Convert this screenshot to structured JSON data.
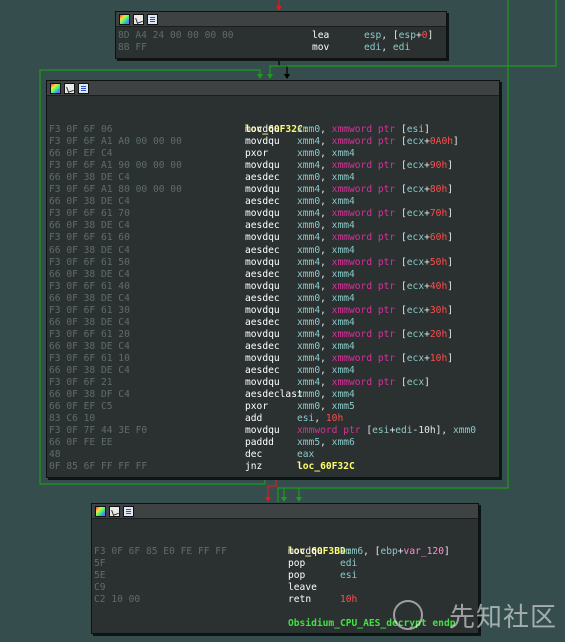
{
  "colors": {
    "background": "#354d4d",
    "node_bg": "#2b3030",
    "edge_green": "#1e9a1e",
    "edge_red": "#d81e1e",
    "edge_black": "#000000",
    "register": "#8ccaca",
    "keyword": "#d9319b",
    "number": "#ff4f4f",
    "label": "#ffff6b",
    "bytes": "#5f6c6c"
  },
  "header_icons": [
    "color-palette-icon",
    "graph-overview-icon",
    "text-view-icon"
  ],
  "top_block": {
    "lines": [
      {
        "bytes": "8D A4 24 00 00 00 00",
        "mnemonic": "lea",
        "ops": [
          {
            "t": "esp",
            "c": "reg"
          },
          {
            "t": ", [",
            "c": "plain"
          },
          {
            "t": "esp",
            "c": "reg"
          },
          {
            "t": "+",
            "c": "plain"
          },
          {
            "t": "0",
            "c": "num"
          },
          {
            "t": "]",
            "c": "plain"
          }
        ]
      },
      {
        "bytes": "8B FF",
        "mnemonic": "mov",
        "ops": [
          {
            "t": "edi",
            "c": "reg"
          },
          {
            "t": ", ",
            "c": "plain"
          },
          {
            "t": "edi",
            "c": "reg"
          }
        ]
      }
    ]
  },
  "main_block": {
    "label": "loc_60F32C:",
    "lines": [
      {
        "bytes": "F3 0F 6F 06",
        "mnemonic": "movdqu",
        "ops": [
          {
            "t": "xmm0",
            "c": "reg"
          },
          {
            "t": ", ",
            "c": "plain"
          },
          {
            "t": "xmmword ptr",
            "c": "kw"
          },
          {
            "t": " [",
            "c": "plain"
          },
          {
            "t": "esi",
            "c": "reg"
          },
          {
            "t": "]",
            "c": "plain"
          }
        ]
      },
      {
        "bytes": "F3 0F 6F A1 A0 00 00 00",
        "mnemonic": "movdqu",
        "ops": [
          {
            "t": "xmm4",
            "c": "reg"
          },
          {
            "t": ", ",
            "c": "plain"
          },
          {
            "t": "xmmword ptr",
            "c": "kw"
          },
          {
            "t": " [",
            "c": "plain"
          },
          {
            "t": "ecx",
            "c": "reg"
          },
          {
            "t": "+",
            "c": "plain"
          },
          {
            "t": "0A0h",
            "c": "num"
          },
          {
            "t": "]",
            "c": "plain"
          }
        ]
      },
      {
        "bytes": "66 0F EF C4",
        "mnemonic": "pxor",
        "ops": [
          {
            "t": "xmm0",
            "c": "reg"
          },
          {
            "t": ", ",
            "c": "plain"
          },
          {
            "t": "xmm4",
            "c": "reg"
          }
        ]
      },
      {
        "bytes": "F3 0F 6F A1 90 00 00 00",
        "mnemonic": "movdqu",
        "ops": [
          {
            "t": "xmm4",
            "c": "reg"
          },
          {
            "t": ", ",
            "c": "plain"
          },
          {
            "t": "xmmword ptr",
            "c": "kw"
          },
          {
            "t": " [",
            "c": "plain"
          },
          {
            "t": "ecx",
            "c": "reg"
          },
          {
            "t": "+",
            "c": "plain"
          },
          {
            "t": "90h",
            "c": "num"
          },
          {
            "t": "]",
            "c": "plain"
          }
        ]
      },
      {
        "bytes": "66 0F 38 DE C4",
        "mnemonic": "aesdec",
        "ops": [
          {
            "t": "xmm0",
            "c": "reg"
          },
          {
            "t": ", ",
            "c": "plain"
          },
          {
            "t": "xmm4",
            "c": "reg"
          }
        ]
      },
      {
        "bytes": "F3 0F 6F A1 80 00 00 00",
        "mnemonic": "movdqu",
        "ops": [
          {
            "t": "xmm4",
            "c": "reg"
          },
          {
            "t": ", ",
            "c": "plain"
          },
          {
            "t": "xmmword ptr",
            "c": "kw"
          },
          {
            "t": " [",
            "c": "plain"
          },
          {
            "t": "ecx",
            "c": "reg"
          },
          {
            "t": "+",
            "c": "plain"
          },
          {
            "t": "80h",
            "c": "num"
          },
          {
            "t": "]",
            "c": "plain"
          }
        ]
      },
      {
        "bytes": "66 0F 38 DE C4",
        "mnemonic": "aesdec",
        "ops": [
          {
            "t": "xmm0",
            "c": "reg"
          },
          {
            "t": ", ",
            "c": "plain"
          },
          {
            "t": "xmm4",
            "c": "reg"
          }
        ]
      },
      {
        "bytes": "F3 0F 6F 61 70",
        "mnemonic": "movdqu",
        "ops": [
          {
            "t": "xmm4",
            "c": "reg"
          },
          {
            "t": ", ",
            "c": "plain"
          },
          {
            "t": "xmmword ptr",
            "c": "kw"
          },
          {
            "t": " [",
            "c": "plain"
          },
          {
            "t": "ecx",
            "c": "reg"
          },
          {
            "t": "+",
            "c": "plain"
          },
          {
            "t": "70h",
            "c": "num"
          },
          {
            "t": "]",
            "c": "plain"
          }
        ]
      },
      {
        "bytes": "66 0F 38 DE C4",
        "mnemonic": "aesdec",
        "ops": [
          {
            "t": "xmm0",
            "c": "reg"
          },
          {
            "t": ", ",
            "c": "plain"
          },
          {
            "t": "xmm4",
            "c": "reg"
          }
        ]
      },
      {
        "bytes": "F3 0F 6F 61 60",
        "mnemonic": "movdqu",
        "ops": [
          {
            "t": "xmm4",
            "c": "reg"
          },
          {
            "t": ", ",
            "c": "plain"
          },
          {
            "t": "xmmword ptr",
            "c": "kw"
          },
          {
            "t": " [",
            "c": "plain"
          },
          {
            "t": "ecx",
            "c": "reg"
          },
          {
            "t": "+",
            "c": "plain"
          },
          {
            "t": "60h",
            "c": "num"
          },
          {
            "t": "]",
            "c": "plain"
          }
        ]
      },
      {
        "bytes": "66 0F 38 DE C4",
        "mnemonic": "aesdec",
        "ops": [
          {
            "t": "xmm0",
            "c": "reg"
          },
          {
            "t": ", ",
            "c": "plain"
          },
          {
            "t": "xmm4",
            "c": "reg"
          }
        ]
      },
      {
        "bytes": "F3 0F 6F 61 50",
        "mnemonic": "movdqu",
        "ops": [
          {
            "t": "xmm4",
            "c": "reg"
          },
          {
            "t": ", ",
            "c": "plain"
          },
          {
            "t": "xmmword ptr",
            "c": "kw"
          },
          {
            "t": " [",
            "c": "plain"
          },
          {
            "t": "ecx",
            "c": "reg"
          },
          {
            "t": "+",
            "c": "plain"
          },
          {
            "t": "50h",
            "c": "num"
          },
          {
            "t": "]",
            "c": "plain"
          }
        ]
      },
      {
        "bytes": "66 0F 38 DE C4",
        "mnemonic": "aesdec",
        "ops": [
          {
            "t": "xmm0",
            "c": "reg"
          },
          {
            "t": ", ",
            "c": "plain"
          },
          {
            "t": "xmm4",
            "c": "reg"
          }
        ]
      },
      {
        "bytes": "F3 0F 6F 61 40",
        "mnemonic": "movdqu",
        "ops": [
          {
            "t": "xmm4",
            "c": "reg"
          },
          {
            "t": ", ",
            "c": "plain"
          },
          {
            "t": "xmmword ptr",
            "c": "kw"
          },
          {
            "t": " [",
            "c": "plain"
          },
          {
            "t": "ecx",
            "c": "reg"
          },
          {
            "t": "+",
            "c": "plain"
          },
          {
            "t": "40h",
            "c": "num"
          },
          {
            "t": "]",
            "c": "plain"
          }
        ]
      },
      {
        "bytes": "66 0F 38 DE C4",
        "mnemonic": "aesdec",
        "ops": [
          {
            "t": "xmm0",
            "c": "reg"
          },
          {
            "t": ", ",
            "c": "plain"
          },
          {
            "t": "xmm4",
            "c": "reg"
          }
        ]
      },
      {
        "bytes": "F3 0F 6F 61 30",
        "mnemonic": "movdqu",
        "ops": [
          {
            "t": "xmm4",
            "c": "reg"
          },
          {
            "t": ", ",
            "c": "plain"
          },
          {
            "t": "xmmword ptr",
            "c": "kw"
          },
          {
            "t": " [",
            "c": "plain"
          },
          {
            "t": "ecx",
            "c": "reg"
          },
          {
            "t": "+",
            "c": "plain"
          },
          {
            "t": "30h",
            "c": "num"
          },
          {
            "t": "]",
            "c": "plain"
          }
        ]
      },
      {
        "bytes": "66 0F 38 DE C4",
        "mnemonic": "aesdec",
        "ops": [
          {
            "t": "xmm0",
            "c": "reg"
          },
          {
            "t": ", ",
            "c": "plain"
          },
          {
            "t": "xmm4",
            "c": "reg"
          }
        ]
      },
      {
        "bytes": "F3 0F 6F 61 20",
        "mnemonic": "movdqu",
        "ops": [
          {
            "t": "xmm4",
            "c": "reg"
          },
          {
            "t": ", ",
            "c": "plain"
          },
          {
            "t": "xmmword ptr",
            "c": "kw"
          },
          {
            "t": " [",
            "c": "plain"
          },
          {
            "t": "ecx",
            "c": "reg"
          },
          {
            "t": "+",
            "c": "plain"
          },
          {
            "t": "20h",
            "c": "num"
          },
          {
            "t": "]",
            "c": "plain"
          }
        ]
      },
      {
        "bytes": "66 0F 38 DE C4",
        "mnemonic": "aesdec",
        "ops": [
          {
            "t": "xmm0",
            "c": "reg"
          },
          {
            "t": ", ",
            "c": "plain"
          },
          {
            "t": "xmm4",
            "c": "reg"
          }
        ]
      },
      {
        "bytes": "F3 0F 6F 61 10",
        "mnemonic": "movdqu",
        "ops": [
          {
            "t": "xmm4",
            "c": "reg"
          },
          {
            "t": ", ",
            "c": "plain"
          },
          {
            "t": "xmmword ptr",
            "c": "kw"
          },
          {
            "t": " [",
            "c": "plain"
          },
          {
            "t": "ecx",
            "c": "reg"
          },
          {
            "t": "+",
            "c": "plain"
          },
          {
            "t": "10h",
            "c": "num"
          },
          {
            "t": "]",
            "c": "plain"
          }
        ]
      },
      {
        "bytes": "66 0F 38 DE C4",
        "mnemonic": "aesdec",
        "ops": [
          {
            "t": "xmm0",
            "c": "reg"
          },
          {
            "t": ", ",
            "c": "plain"
          },
          {
            "t": "xmm4",
            "c": "reg"
          }
        ]
      },
      {
        "bytes": "F3 0F 6F 21",
        "mnemonic": "movdqu",
        "ops": [
          {
            "t": "xmm4",
            "c": "reg"
          },
          {
            "t": ", ",
            "c": "plain"
          },
          {
            "t": "xmmword ptr",
            "c": "kw"
          },
          {
            "t": " [",
            "c": "plain"
          },
          {
            "t": "ecx",
            "c": "reg"
          },
          {
            "t": "]",
            "c": "plain"
          }
        ]
      },
      {
        "bytes": "66 0F 38 DF C4",
        "mnemonic": "aesdeclast",
        "ops": [
          {
            "t": "xmm0",
            "c": "reg"
          },
          {
            "t": ", ",
            "c": "plain"
          },
          {
            "t": "xmm4",
            "c": "reg"
          }
        ]
      },
      {
        "bytes": "66 0F EF C5",
        "mnemonic": "pxor",
        "ops": [
          {
            "t": "xmm0",
            "c": "reg"
          },
          {
            "t": ", ",
            "c": "plain"
          },
          {
            "t": "xmm5",
            "c": "reg"
          }
        ]
      },
      {
        "bytes": "83 C6 10",
        "mnemonic": "add",
        "ops": [
          {
            "t": "esi",
            "c": "reg"
          },
          {
            "t": ", ",
            "c": "plain"
          },
          {
            "t": "10h",
            "c": "num"
          }
        ]
      },
      {
        "bytes": "F3 0F 7F 44 3E F0",
        "mnemonic": "movdqu",
        "ops": [
          {
            "t": "xmmword ptr",
            "c": "kw"
          },
          {
            "t": " [",
            "c": "plain"
          },
          {
            "t": "esi",
            "c": "reg"
          },
          {
            "t": "+",
            "c": "plain"
          },
          {
            "t": "edi",
            "c": "reg"
          },
          {
            "t": "-10h], ",
            "c": "plain"
          },
          {
            "t": "xmm0",
            "c": "reg"
          }
        ]
      },
      {
        "bytes": "66 0F FE EE",
        "mnemonic": "paddd",
        "ops": [
          {
            "t": "xmm5",
            "c": "reg"
          },
          {
            "t": ", ",
            "c": "plain"
          },
          {
            "t": "xmm6",
            "c": "reg"
          }
        ]
      },
      {
        "bytes": "48",
        "mnemonic": "dec",
        "ops": [
          {
            "t": "eax",
            "c": "reg"
          }
        ]
      },
      {
        "bytes": "0F 85 6F FF FF FF",
        "mnemonic": "jnz",
        "ops": [
          {
            "t": "loc_60F32C",
            "c": "loc"
          }
        ]
      }
    ]
  },
  "bottom_block": {
    "label": "loc_60F3BD:",
    "lines": [
      {
        "bytes": "F3 0F 6F 85 E0 FE FF FF",
        "mnemonic": "movdqu",
        "ops": [
          {
            "t": "xmm6",
            "c": "reg"
          },
          {
            "t": ", [",
            "c": "plain"
          },
          {
            "t": "ebp",
            "c": "reg"
          },
          {
            "t": "+",
            "c": "plain"
          },
          {
            "t": "var_120",
            "c": "name"
          },
          {
            "t": "]",
            "c": "plain"
          }
        ]
      },
      {
        "bytes": "5F",
        "mnemonic": "pop",
        "ops": [
          {
            "t": "edi",
            "c": "reg"
          }
        ]
      },
      {
        "bytes": "5E",
        "mnemonic": "pop",
        "ops": [
          {
            "t": "esi",
            "c": "reg"
          }
        ]
      },
      {
        "bytes": "C9",
        "mnemonic": "leave",
        "ops": []
      },
      {
        "bytes": "C2 10 00",
        "mnemonic": "retn",
        "ops": [
          {
            "t": "10h",
            "c": "num"
          }
        ]
      }
    ],
    "endp": "Obsidium_CPU_AES_decrypt endp"
  },
  "watermark": "先知社区"
}
